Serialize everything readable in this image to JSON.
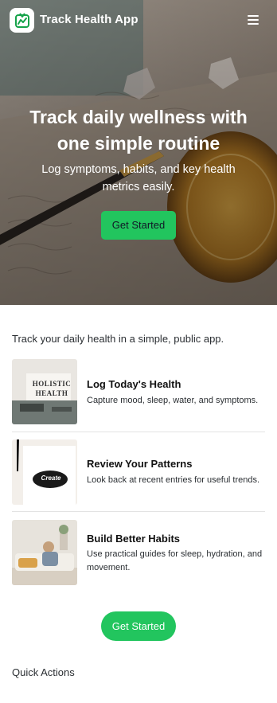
{
  "header": {
    "app_title": "Track Health App",
    "logo_icon": "health-chart-icon",
    "menu_icon": "hamburger-menu-icon"
  },
  "hero": {
    "title": "Track daily wellness with one simple routine",
    "subtitle": "Log symptoms, habits, and key health metrics easily.",
    "cta_label": "Get Started"
  },
  "intro": "Track your daily health in a simple, public app.",
  "features": [
    {
      "title": "Log Today's Health",
      "description": "Capture mood, sleep, water, and symptoms.",
      "thumb_text_1": "HOLISTIC",
      "thumb_text_2": "HEALTH"
    },
    {
      "title": "Review Your Patterns",
      "description": "Look back at recent entries for useful trends.",
      "thumb_text_1": "Create"
    },
    {
      "title": "Build Better Habits",
      "description": "Use practical guides for sleep, hydration, and movement."
    }
  ],
  "cta": {
    "label": "Get Started"
  },
  "quick_actions": {
    "heading": "Quick Actions"
  },
  "colors": {
    "accent": "#22c55e",
    "logo_green": "#16a34a"
  }
}
